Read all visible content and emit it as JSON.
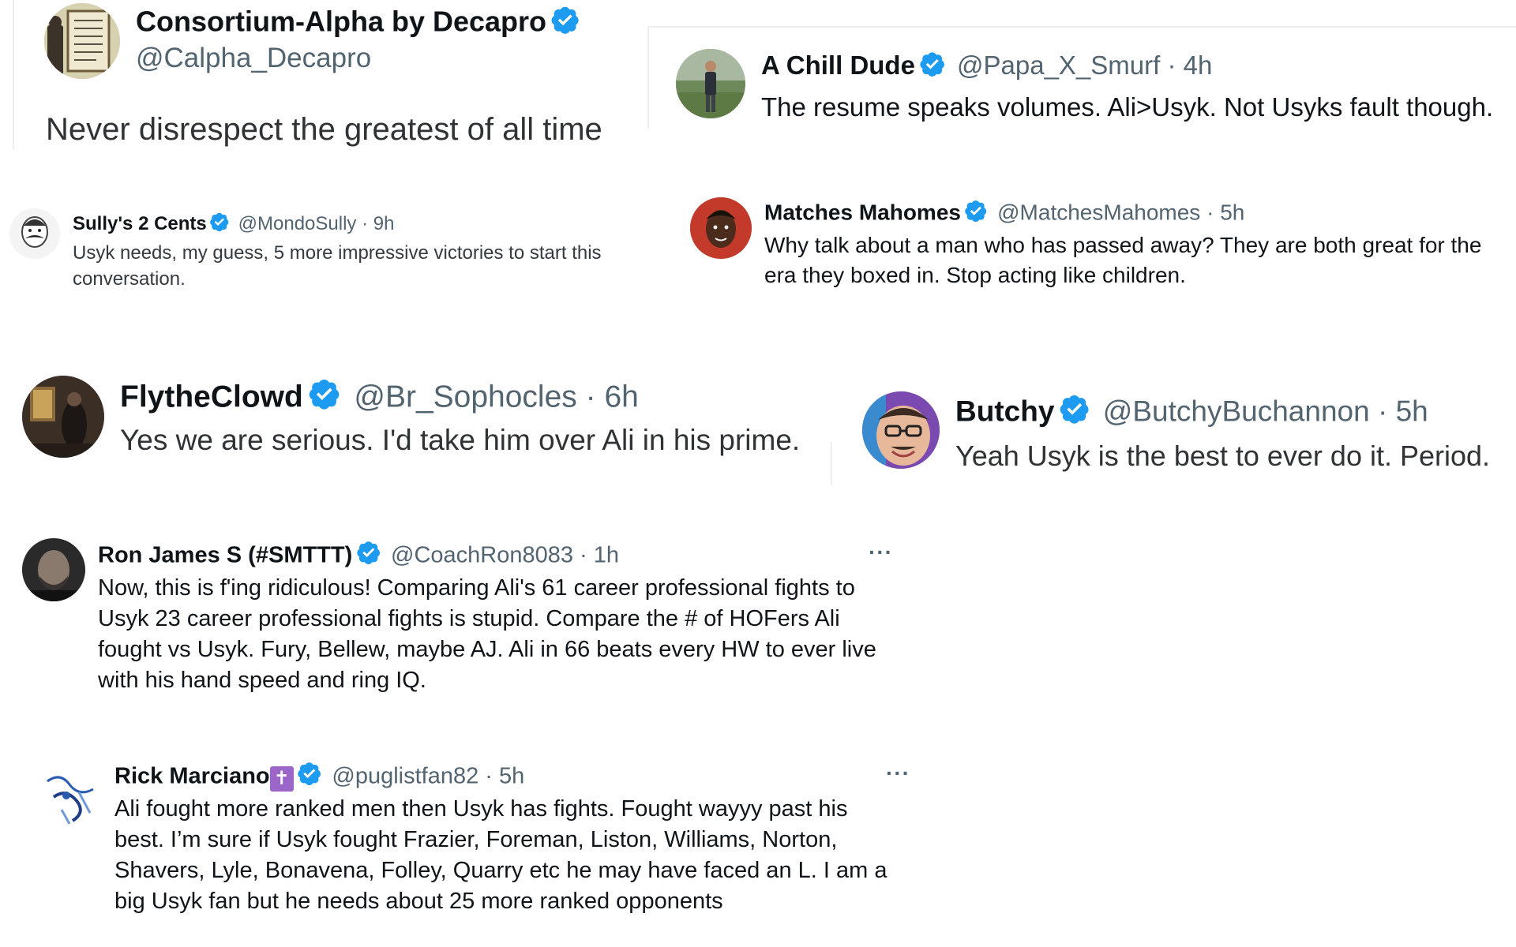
{
  "tweets": [
    {
      "name": "Consortium-Alpha by Decapro",
      "handle": "@Calpha_Decapro",
      "meta": "",
      "text": "Never disrespect the greatest of all time",
      "avatar_icon": "framed-document-icon"
    },
    {
      "name": "A Chill Dude",
      "handle": "@Papa_X_Smurf",
      "meta": "· 4h",
      "text": "The resume speaks volumes. Ali>Usyk. Not Usyks fault though.",
      "avatar_icon": "person-outdoors-icon"
    },
    {
      "name": "Sully's 2 Cents",
      "handle": "@MondoSully",
      "meta": "· 9h",
      "text_lines": [
        "Usyk needs, my guess, 5 more impressive victories to start this",
        "conversation."
      ],
      "avatar_icon": "mustache-cartoon-icon"
    },
    {
      "name": "Matches Mahomes",
      "handle": "@MatchesMahomes",
      "meta": "· 5h",
      "text_lines": [
        "Why talk about a man who has passed away? They are both great for the",
        "era they boxed in. Stop acting like children."
      ],
      "avatar_icon": "man-portrait-icon"
    },
    {
      "name": "FlytheClowd",
      "handle": "@Br_Sophocles",
      "meta": "· 6h",
      "text": "Yes we are serious. I'd take him over Ali in his prime.",
      "avatar_icon": "dark-painting-icon"
    },
    {
      "name": "Butchy",
      "handle": "@ButchyBuchannon",
      "meta": "· 5h",
      "text": "Yeah Usyk is the best to ever do it. Period.",
      "avatar_icon": "smiling-face-glasses-icon"
    },
    {
      "name": "Ron James S (#SMTTT)",
      "handle": "@CoachRon8083",
      "meta": "· 1h",
      "more": "···",
      "text_lines": [
        "Now, this is f'ing ridiculous! Comparing Ali's 61 career professional fights to",
        "Usyk 23 career professional fights is stupid. Compare the # of HOFers Ali",
        "fought vs Usyk. Fury,  Bellew, maybe AJ. Ali in 66 beats every HW to ever live",
        "with his hand speed and ring IQ."
      ],
      "avatar_icon": "bald-man-icon"
    },
    {
      "name": "Rick Marciano",
      "emoji": "✝",
      "handle": "@puglistfan82",
      "meta": "· 5h",
      "more": "···",
      "text_lines": [
        "Ali fought more ranked men then Usyk has fights. Fought wayyy past his",
        "best. I’m sure if Usyk fought Frazier, Foreman, Liston, Williams, Norton,",
        "Shavers, Lyle, Bonavena, Folley, Quarry etc he may have faced an L. I am a",
        "big Usyk fan but he needs about 25 more ranked opponents"
      ],
      "avatar_icon": "blue-sketch-icon"
    }
  ],
  "colors": {
    "verified": "#1d9bf0",
    "muted": "#536471",
    "text": "#0f1419",
    "cross_emoji": "#9c65c8"
  }
}
